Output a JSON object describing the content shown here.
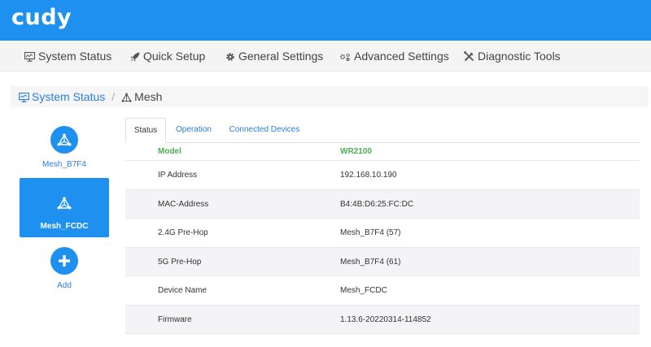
{
  "brand": {
    "logo": "cudy",
    "color": "#1e90f0"
  },
  "nav": {
    "items": [
      {
        "label": "System Status",
        "icon": "monitor-icon"
      },
      {
        "label": "Quick Setup",
        "icon": "rocket-icon"
      },
      {
        "label": "General Settings",
        "icon": "gear-icon"
      },
      {
        "label": "Advanced Settings",
        "icon": "advanced-settings-icon"
      },
      {
        "label": "Diagnostic Tools",
        "icon": "tools-icon"
      }
    ]
  },
  "breadcrumb": {
    "parent": "System Status",
    "separator": "/",
    "current": "Mesh"
  },
  "mesh_nodes": [
    {
      "label": "Mesh_B7F4",
      "icon": "mesh-icon",
      "active": false
    },
    {
      "label": "Mesh_FCDC",
      "icon": "mesh-icon",
      "active": true
    },
    {
      "label": "Add",
      "icon": "plus-icon",
      "active": false
    }
  ],
  "tabs": [
    {
      "label": "Status",
      "active": true
    },
    {
      "label": "Operation",
      "active": false
    },
    {
      "label": "Connected Devices",
      "active": false
    }
  ],
  "table": {
    "header": {
      "key": "Model",
      "value": "WR2100"
    },
    "rows": [
      {
        "key": "IP Address",
        "value": "192.168.10.190"
      },
      {
        "key": "MAC-Address",
        "value": "B4:4B:D6:25:FC:DC"
      },
      {
        "key": "2.4G Pre-Hop",
        "value": "Mesh_B7F4 (57)"
      },
      {
        "key": "5G Pre-Hop",
        "value": "Mesh_B7F4 (61)"
      },
      {
        "key": "Device Name",
        "value": "Mesh_FCDC"
      },
      {
        "key": "Firmware",
        "value": "1.13.6-20220314-114852"
      }
    ]
  }
}
